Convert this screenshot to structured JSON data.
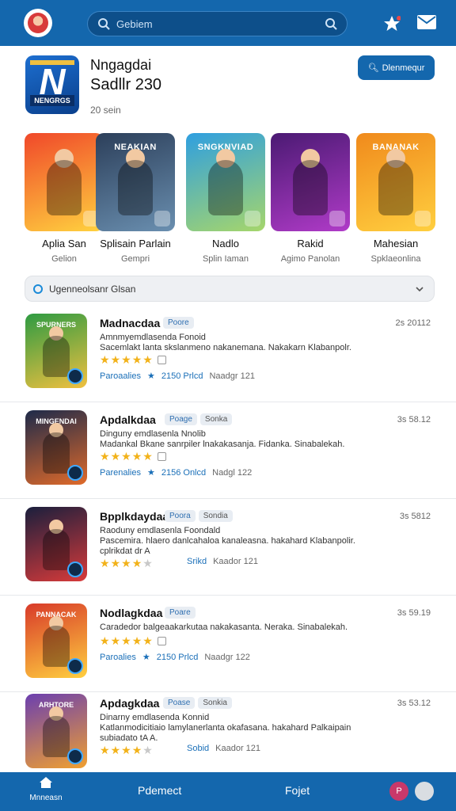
{
  "topbar": {
    "search_placeholder": "Gebiem"
  },
  "app": {
    "name": "Nngagdai",
    "subtitle": "Sadllr 230",
    "meta": "20 sein",
    "button": "Dlenmequr",
    "logo_text": "NENGRGS"
  },
  "featured": [
    {
      "title": "Aplia San",
      "sub": "Gelion",
      "banner": "",
      "colors": [
        "#f0482a",
        "#ffd23f"
      ]
    },
    {
      "title": "Splisain Parlain",
      "sub": "Gempri",
      "banner": "NEAKIAN",
      "colors": [
        "#2c3f5a",
        "#6a8fb0"
      ]
    },
    {
      "title": "Nadlo",
      "sub": "Splin Iaman",
      "banner": "SNGKNVIAD",
      "colors": [
        "#2f9fe0",
        "#a6d66b"
      ]
    },
    {
      "title": "Rakid",
      "sub": "Agimo Panolan",
      "banner": "",
      "colors": [
        "#4b1a73",
        "#b03bc8"
      ]
    },
    {
      "title": "Mahesian",
      "sub": "Spklaeonlina",
      "banner": "BANANAK",
      "colors": [
        "#f08a1c",
        "#ffcf3f"
      ]
    }
  ],
  "filter": {
    "label": "Ugenneolsanr Glsan"
  },
  "list": [
    {
      "name": "Madnacdaa",
      "tags": [
        "Poore"
      ],
      "date": "2s 20112",
      "desc": [
        "Amnmyemdlasenda Fonoid",
        "Sacemlakt lanta skslanmeno nakanemana. Nakakarn Klabanpolr."
      ],
      "stars": 5,
      "foot": {
        "link": "Paroaalies",
        "count": "2150 Prlcd",
        "extra": "Naadgr 121"
      },
      "banner": "SPURNERS",
      "colors": [
        "#2e9b42",
        "#f0c040"
      ]
    },
    {
      "name": "Apdalkdaa",
      "tags": [
        "Poage",
        "Sonka"
      ],
      "date": "3s 58.12",
      "desc": [
        "Dinguny emdlasenla Nnolib",
        "Madankal Bkane sanrpiler lnakakasanja. Fidanka. Sinabalekah."
      ],
      "stars": 5,
      "foot": {
        "link": "Parenalies",
        "count": "2156 Onlcd",
        "extra": "Nadgl 122"
      },
      "banner": "MINGENDAI",
      "colors": [
        "#1d2a4a",
        "#e06a2a"
      ]
    },
    {
      "name": "Bpplkdaydaa",
      "tags": [
        "Poora",
        "Sondia"
      ],
      "date": "3s 5812",
      "desc": [
        "Raoduny emdlasenla Foondald",
        "Pascemira. hlaero danlcahaloa kanaleasna. hakahard Klabanpolir.",
        "cplrikdat dr A"
      ],
      "stars": 4,
      "foot": {
        "link": "",
        "count": "Srikd",
        "extra": "Kaador 121"
      },
      "banner": "",
      "colors": [
        "#1a1f3d",
        "#d83a3a"
      ]
    },
    {
      "name": "Nodlagkdaa",
      "tags": [
        "Poare"
      ],
      "date": "3s 59.19",
      "desc": [
        "Caradedor balgeaakarkutaa nakakasanta. Neraka. Sinabalekah."
      ],
      "stars": 5,
      "foot": {
        "link": "Paroalies",
        "count": "2150 Prlcd",
        "extra": "Naadgr 122"
      },
      "banner": "PANNACAK",
      "colors": [
        "#d83a2a",
        "#ffcf3f"
      ]
    },
    {
      "name": "Apdagkdaa",
      "tags": [
        "Poase",
        "Sonkia"
      ],
      "date": "3s 53.12",
      "desc": [
        "Dinarny emdlasenda Konnid",
        "Katlanmodicitiaio lamylanerlanta okafasana. hakahard Palkaipain",
        "subiadato tA A."
      ],
      "stars": 4,
      "foot": {
        "link": "",
        "count": "Sobid",
        "extra": "Kaador 121"
      },
      "banner": "ARHTORE",
      "colors": [
        "#6b3fb0",
        "#f0a030"
      ]
    }
  ],
  "bottomnav": {
    "home": "Mnneasn",
    "item1": "Pdemect",
    "item2": "Fojet",
    "badge": "P"
  }
}
